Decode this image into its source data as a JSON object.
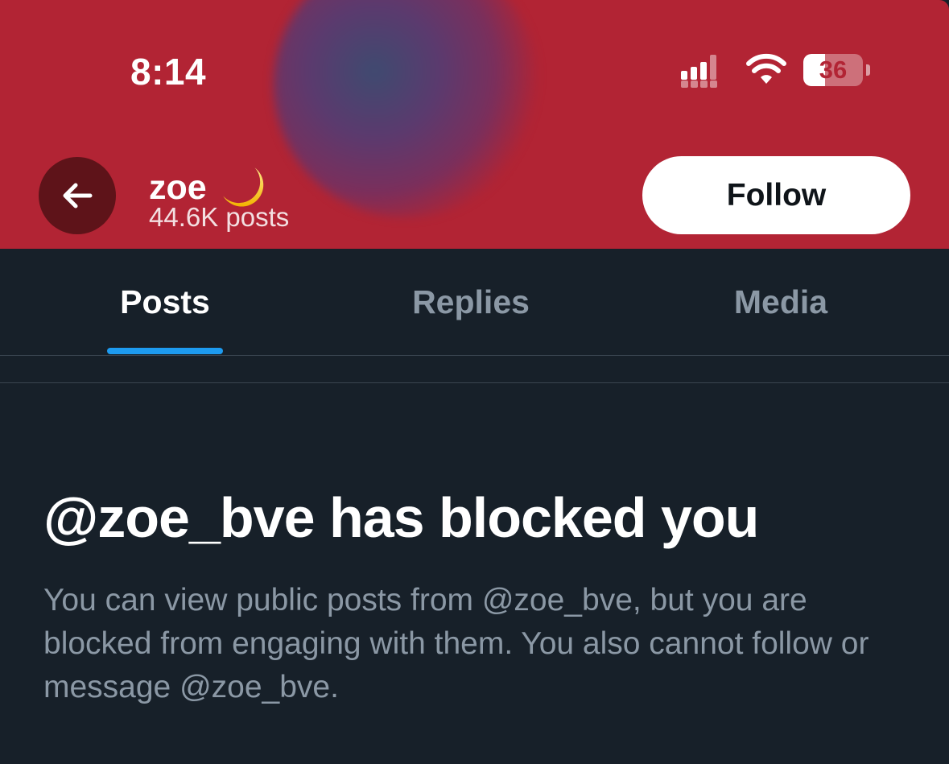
{
  "status_bar": {
    "time": "8:14",
    "battery_percent": "36",
    "battery_level": 0.36,
    "signal_icon": "cellular-signal-icon",
    "wifi_icon": "wifi-icon"
  },
  "header": {
    "back_icon": "arrow-left-icon",
    "profile_name": "zoe",
    "name_emoji_icon": "crescent-moon-icon",
    "post_count": "44.6K posts",
    "follow_label": "Follow",
    "banner_color": "#b22434"
  },
  "tabs": [
    {
      "label": "Posts",
      "active": true
    },
    {
      "label": "Replies",
      "active": false
    },
    {
      "label": "Media",
      "active": false
    }
  ],
  "blocked": {
    "title": "@zoe_bve has blocked you",
    "description": "You can view public posts from @zoe_bve, but you are blocked from engaging with them. You also cannot follow or message @zoe_bve."
  },
  "colors": {
    "accent": "#1d9bf0",
    "background": "#172029",
    "muted_text": "#8b98a5"
  }
}
